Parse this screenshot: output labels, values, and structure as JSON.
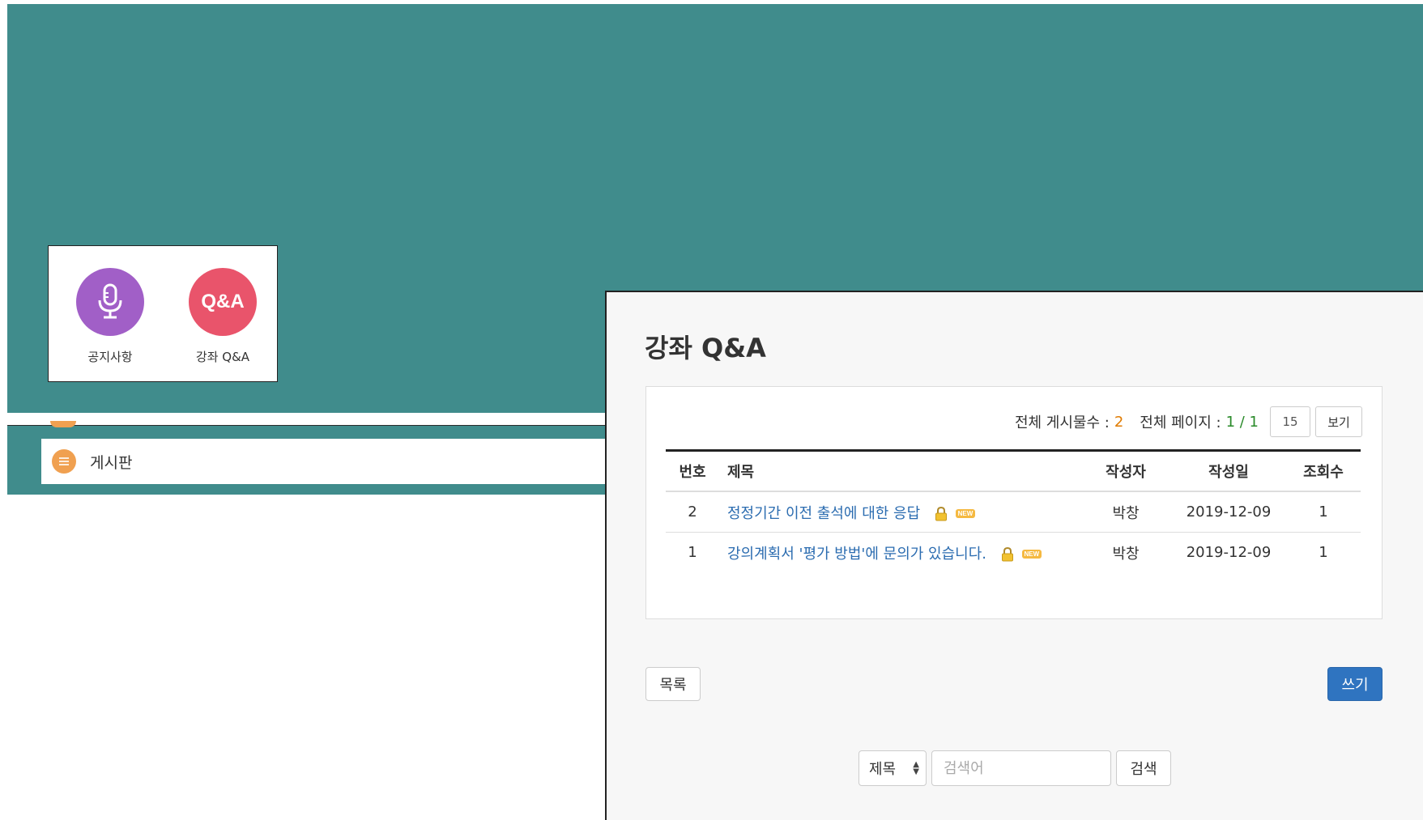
{
  "quick_links": [
    {
      "label": "공지사항",
      "icon": "microphone-icon",
      "color": "#a15fc7"
    },
    {
      "label": "강좌 Q&A",
      "icon_text": "Q&A",
      "color": "#e9546b"
    }
  ],
  "board_menu": {
    "label": "게시판",
    "icon": "list-icon",
    "color": "#f0a050"
  },
  "panel": {
    "title": "강좌 Q&A",
    "info": {
      "total_posts_label": "전체 게시물수 :",
      "total_posts": "2",
      "total_pages_label": "전체 페이지 :",
      "total_pages": "1 / 1",
      "per_page": "15",
      "view_button": "보기"
    },
    "table": {
      "headers": {
        "no": "번호",
        "title": "제목",
        "author": "작성자",
        "date": "작성일",
        "views": "조회수"
      },
      "rows": [
        {
          "no": "2",
          "title": "정정기간 이전 출석에 대한 응답",
          "author": "박창",
          "date": "2019-12-09",
          "views": "1",
          "locked": true,
          "new_badge": "NEW"
        },
        {
          "no": "1",
          "title": "강의계획서 '평가 방법'에 문의가 있습니다.",
          "author": "박창",
          "date": "2019-12-09",
          "views": "1",
          "locked": true,
          "new_badge": "NEW"
        }
      ]
    },
    "list_button": "목록",
    "write_button": "쓰기",
    "search": {
      "select_value": "제목",
      "input_placeholder": "검색어",
      "button": "검색"
    }
  },
  "colors": {
    "teal": "#408c8c",
    "link": "#2b6cb0",
    "primary_button": "#2f74c0"
  }
}
